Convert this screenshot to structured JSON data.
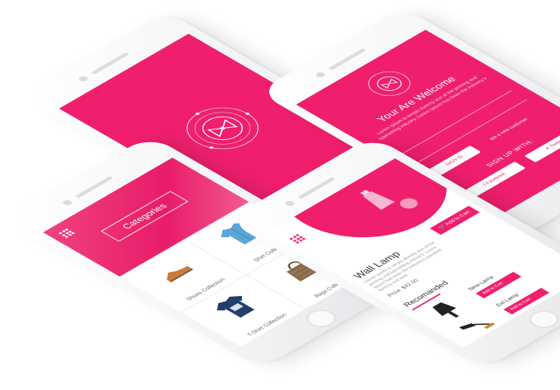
{
  "colors": {
    "brand": "#ef1f6e",
    "device": "#f3f3f5"
  },
  "splash": {
    "logo": "bow-tie-icon"
  },
  "welcome": {
    "title": "Your Are Welcome",
    "intro": "Lorem Ipsum is simply dummy text of the printing and typesetting industry. Lorem Ipsum has been the industry's",
    "sign_in_label": "SIGN IN",
    "new_customer_label": "are a new customer",
    "sign_up_label": "SIGN UP WITH:",
    "facebook_label": "Facebook",
    "twitter_label": "Twitter"
  },
  "categories": {
    "title": "Categories",
    "items": [
      {
        "label": "Shoes Collection",
        "icon": "shoe-icon"
      },
      {
        "label": "Shirt Collection",
        "icon": "shirt-icon"
      },
      {
        "label": "T-Shirt Collection",
        "icon": "tshirt-icon"
      },
      {
        "label": "Bags Collection",
        "icon": "bag-icon"
      }
    ]
  },
  "product": {
    "title": "Wall Lamp",
    "description": "Lorem Ipsum is simply dummy text of the printing and typesetting industry. Lorem Ipsum has been the industry's standard dummy text ever",
    "add_to_cart_label": "Add to Cart",
    "price": "Price: $32.00",
    "recommended_title": "Recomanded",
    "recommended": [
      {
        "name": "New Lamp",
        "button": "Add to Cart"
      },
      {
        "name": "Ext Lamp",
        "button": "Add to Cart"
      }
    ]
  }
}
